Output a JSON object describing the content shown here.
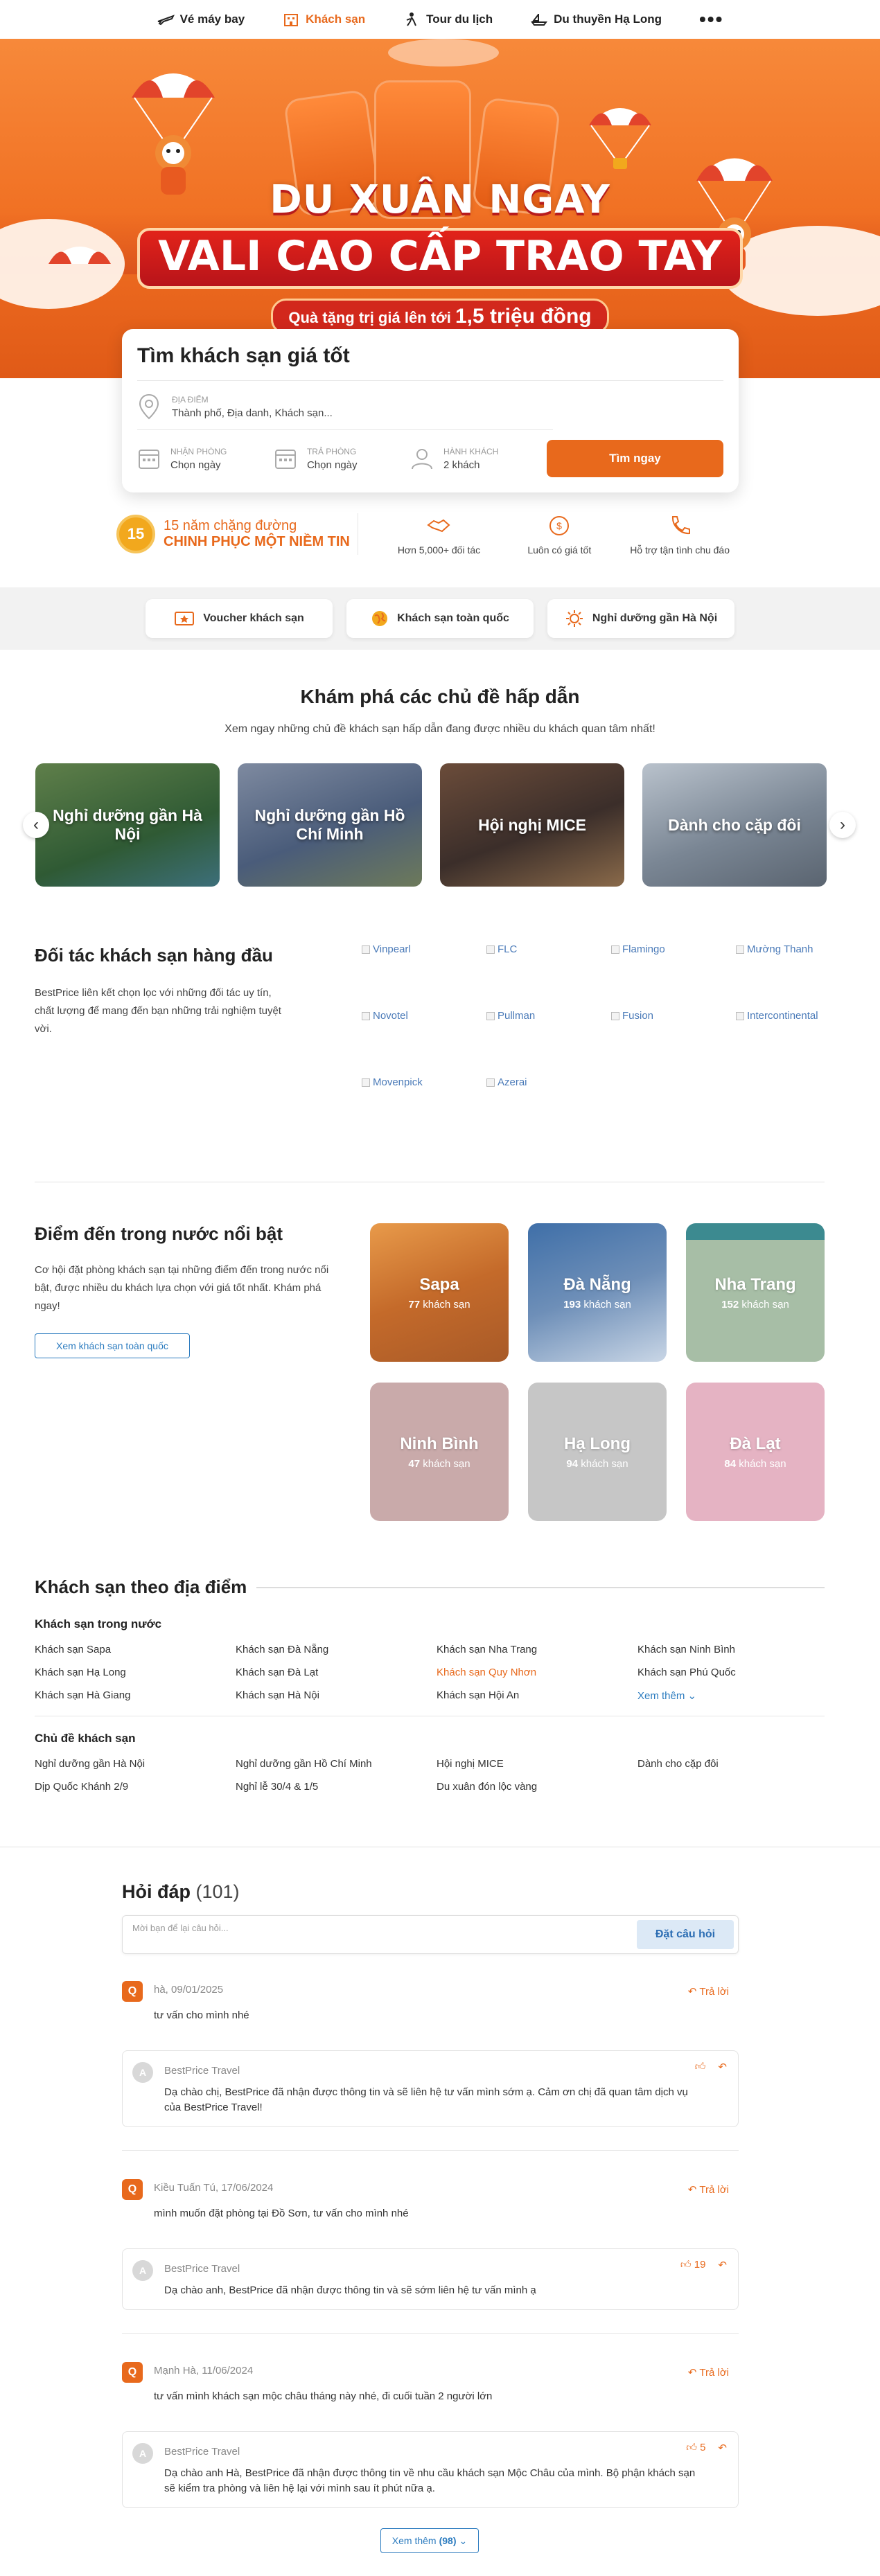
{
  "nav": {
    "items": [
      {
        "label": "Vé máy bay",
        "icon": "plane-icon",
        "active": false
      },
      {
        "label": "Khách sạn",
        "icon": "hotel-icon",
        "active": true
      },
      {
        "label": "Tour du lịch",
        "icon": "tour-icon",
        "active": false
      },
      {
        "label": "Du thuyền Hạ Long",
        "icon": "cruise-icon",
        "active": false
      }
    ],
    "more": "•••"
  },
  "hero": {
    "line1": "DU XUÂN NGAY",
    "line2": "VALI CAO CẤP TRAO TAY",
    "line3_prefix": "Quà tặng trị giá lên tới",
    "line3_amount": "1,5 triệu đồng"
  },
  "search": {
    "title": "Tìm khách sạn giá tốt",
    "location_label": "ĐỊA ĐIỂM",
    "location_placeholder": "Thành phố, Địa danh, Khách sạn...",
    "checkin_label": "NHẬN PHÒNG",
    "checkin_value": "Chọn ngày",
    "checkout_label": "TRẢ PHÒNG",
    "checkout_value": "Chọn ngày",
    "guests_label": "HÀNH KHÁCH",
    "guests_value": "2 khách",
    "button": "Tìm ngay"
  },
  "trust": {
    "medal": "15",
    "line1": "15 năm chặng đường",
    "line2": "CHINH PHỤC MỘT NIỀM TIN",
    "features": [
      {
        "label": "Hơn 5,000+ đối tác",
        "icon": "handshake-icon"
      },
      {
        "label": "Luôn có giá tốt",
        "icon": "best-price-icon"
      },
      {
        "label": "Hỗ trợ tận tình chu đáo",
        "icon": "support-phone-icon"
      }
    ]
  },
  "chips": [
    {
      "label": "Voucher khách sạn",
      "icon": "voucher-icon"
    },
    {
      "label": "Khách sạn toàn quốc",
      "icon": "globe-icon"
    },
    {
      "label": "Nghỉ dưỡng gần Hà Nội",
      "icon": "sun-icon"
    }
  ],
  "themes": {
    "title": "Khám phá các chủ đề hấp dẫn",
    "subtitle": "Xem ngay những chủ đề khách sạn hấp dẫn đang được nhiều du khách quan tâm nhất!",
    "cards": [
      {
        "label": "Nghỉ dưỡng gần Hà Nội"
      },
      {
        "label": "Nghỉ dưỡng gần Hồ Chí Minh"
      },
      {
        "label": "Hội nghị MICE"
      },
      {
        "label": "Dành cho cặp đôi"
      }
    ],
    "prev": "‹",
    "next": "›"
  },
  "partners": {
    "title": "Đối tác khách sạn hàng đầu",
    "description": "BestPrice liên kết chọn lọc với những đối tác uy tín, chất lượng để mang đến bạn những trải nghiệm tuyệt vời.",
    "logos": [
      "Vinpearl",
      "FLC",
      "Flamingo",
      "Mường Thanh",
      "Novotel",
      "Pullman",
      "Fusion",
      "Intercontinental",
      "Movenpick",
      "Azerai"
    ]
  },
  "destinations": {
    "title": "Điểm đến trong nước nổi bật",
    "description": "Cơ hội đặt phòng khách sạn tại những điểm đến trong nước nổi bật, được nhiều du khách lựa chọn với giá tốt nhất. Khám phá ngay!",
    "button": "Xem khách sạn toàn quốc",
    "count_suffix": "khách sạn",
    "items": [
      {
        "name": "Sapa",
        "count": "77"
      },
      {
        "name": "Đà Nẵng",
        "count": "193"
      },
      {
        "name": "Nha Trang",
        "count": "152"
      },
      {
        "name": "Ninh Bình",
        "count": "47"
      },
      {
        "name": "Hạ Long",
        "count": "94"
      },
      {
        "name": "Đà Lạt",
        "count": "84"
      }
    ]
  },
  "by_location": {
    "title": "Khách sạn theo địa điểm",
    "domestic_title": "Khách sạn trong nước",
    "domestic": [
      "Khách sạn Sapa",
      "Khách sạn Đà Nẵng",
      "Khách sạn Nha Trang",
      "Khách sạn Ninh Bình",
      "Khách sạn Hạ Long",
      "Khách sạn Đà Lạt",
      "Khách sạn Quy Nhơn",
      "Khách sạn Phú Quốc",
      "Khách sạn Hà Giang",
      "Khách sạn Hà Nội",
      "Khách sạn Hội An",
      "Xem thêm"
    ],
    "themes_title": "Chủ đề khách sạn",
    "themes": [
      "Nghỉ dưỡng gần Hà Nội",
      "Nghỉ dưỡng gần Hồ Chí Minh",
      "Hội nghị MICE",
      "Dành cho cặp đôi",
      "Dịp Quốc Khánh 2/9",
      "Nghỉ lễ 30/4 & 1/5",
      "Du xuân đón lộc vàng"
    ]
  },
  "qa": {
    "title": "Hỏi đáp",
    "count": "(101)",
    "placeholder": "Mời bạn để lại câu hỏi...",
    "ask_button": "Đặt câu hỏi",
    "reply_label": "Trả lời",
    "q_badge": "Q",
    "a_badge": "A",
    "items": [
      {
        "meta": "hà, 09/01/2025",
        "question": "tư vấn cho mình nhé",
        "answer_author": "BestPrice Travel",
        "answer_likes": "",
        "answer": "Dạ chào chị, BestPrice đã nhận được thông tin và sẽ liên hệ tư vấn mình sớm ạ. Cảm ơn chị đã quan tâm dịch vụ của BestPrice Travel!"
      },
      {
        "meta": "Kiều Tuấn Tú, 17/06/2024",
        "question": "mình muốn đặt phòng tại Đồ Sơn, tư vấn cho mình nhé",
        "answer_author": "BestPrice Travel",
        "answer_likes": "19",
        "answer": "Dạ chào anh, BestPrice đã nhận được thông tin và sẽ sớm liên hệ tư vấn mình ạ"
      },
      {
        "meta": "Mạnh Hà, 11/06/2024",
        "question": "tư vấn mình khách sạn mộc châu tháng này nhé, đi cuối tuần 2 người lớn",
        "answer_author": "BestPrice Travel",
        "answer_likes": "5",
        "answer": "Dạ chào anh Hà, BestPrice đã nhận được thông tin về nhu cầu khách sạn Mộc Châu của mình. Bộ phận khách sạn sẽ kiểm tra phòng và liên hệ lại với mình sau ít phút nữa ạ."
      }
    ],
    "see_more_label": "Xem thêm",
    "see_more_count": "(98)"
  },
  "colors": {
    "accent": "#e8691c",
    "link": "#2b7bbf"
  }
}
